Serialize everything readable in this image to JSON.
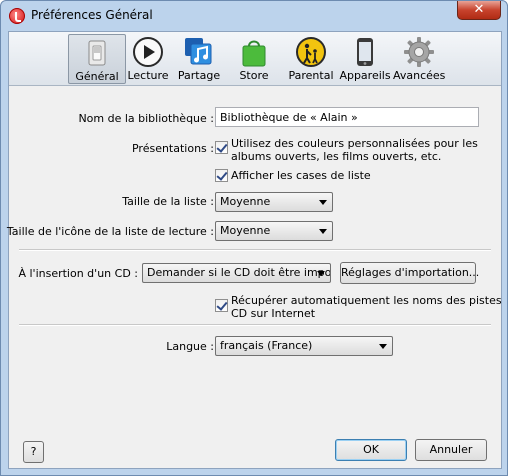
{
  "window": {
    "title": "Préférences Général",
    "close_label": "✕"
  },
  "toolbar": {
    "items": [
      {
        "label": "Général",
        "icon": "switch-icon",
        "selected": true
      },
      {
        "label": "Lecture",
        "icon": "play-icon"
      },
      {
        "label": "Partage",
        "icon": "sharing-icon"
      },
      {
        "label": "Store",
        "icon": "store-bag-icon"
      },
      {
        "label": "Parental",
        "icon": "parental-icon"
      },
      {
        "label": "Appareils",
        "icon": "device-icon"
      },
      {
        "label": "Avancées",
        "icon": "gear-icon"
      }
    ]
  },
  "library": {
    "label": "Nom de la bibliothèque :",
    "value": "Bibliothèque de « Alain »"
  },
  "presentations": {
    "label": "Présentations :",
    "custom_colors": {
      "label_line1": "Utilisez des couleurs personnalisées pour les",
      "label_line2": "albums ouverts, les films ouverts, etc.",
      "checked": true
    },
    "show_checkboxes": {
      "label": "Afficher les cases de liste",
      "checked": true
    }
  },
  "list_size": {
    "label": "Taille de la liste :",
    "value": "Moyenne"
  },
  "playlist_icon_size": {
    "label": "Taille de l'icône de la liste de lecture :",
    "value": "Moyenne"
  },
  "cd_insert": {
    "label": "À l'insertion d'un CD :",
    "value": "Demander si le CD doit être importé",
    "import_settings_button": "Réglages d'importation...",
    "auto_names": {
      "label_line1": "Récupérer automatiquement les noms des pistes",
      "label_line2": "CD sur Internet",
      "checked": true
    }
  },
  "language": {
    "label": "Langue :",
    "value": "français (France)"
  },
  "footer": {
    "help": "?",
    "ok": "OK",
    "cancel": "Annuler"
  }
}
